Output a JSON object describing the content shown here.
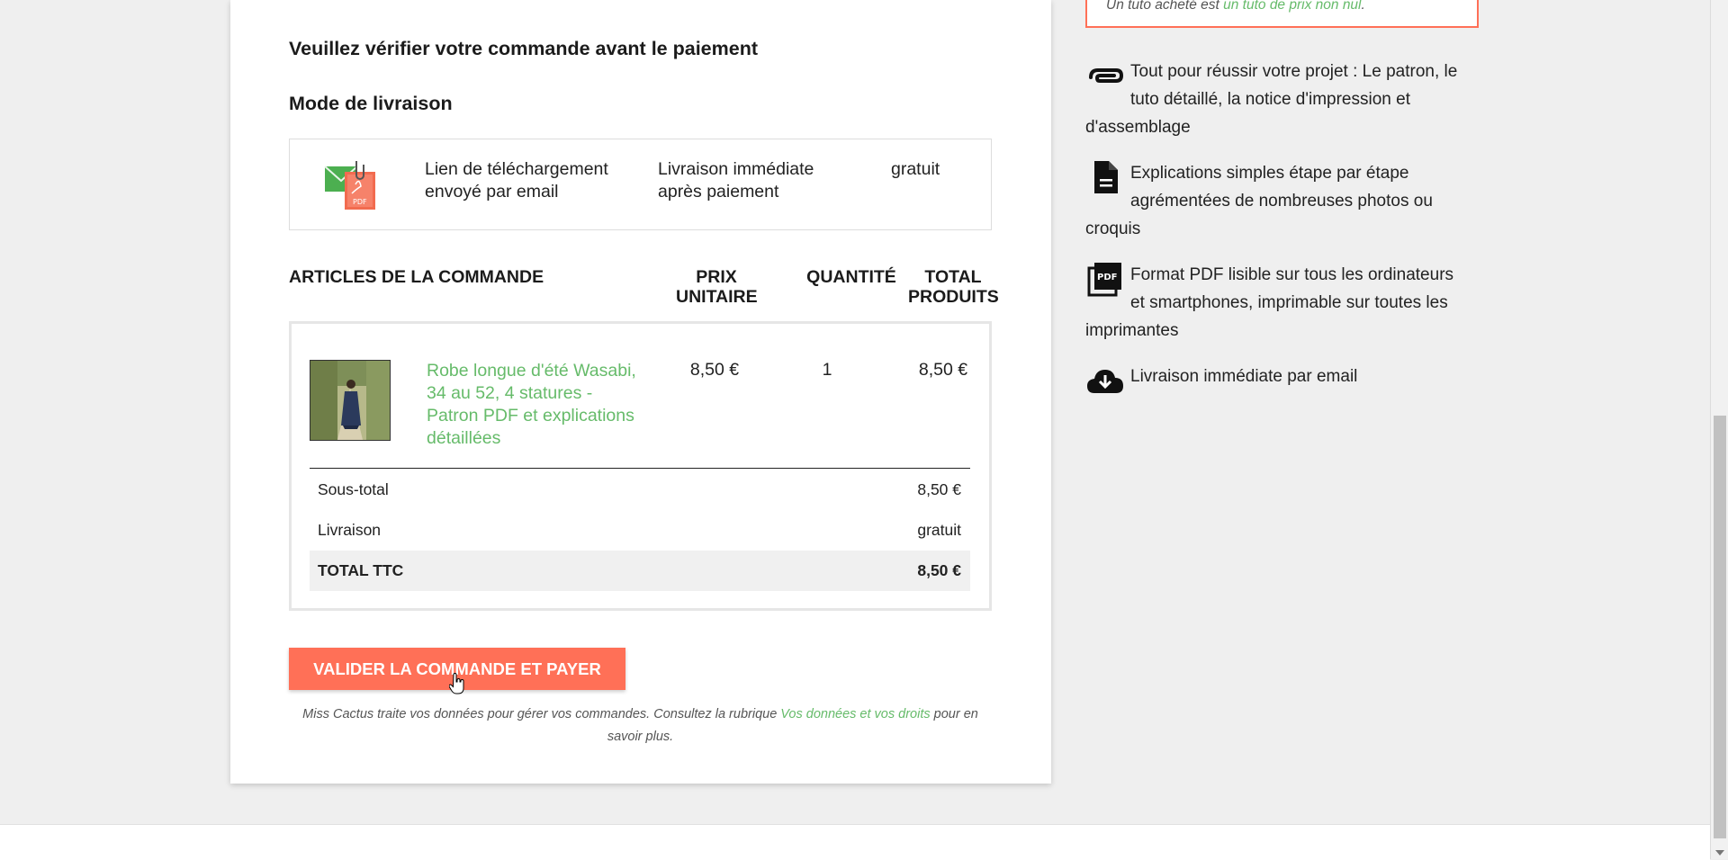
{
  "checkout": {
    "verify_title": "Veuillez vérifier votre commande avant le paiement",
    "shipping_title": "Mode de livraison",
    "shipping": {
      "icon": "pdf-email-icon",
      "method": "Lien de téléchargement envoyé par email",
      "delay": "Livraison immédiate après paiement",
      "price": "gratuit"
    },
    "table_headers": {
      "articles": "ARTICLES DE LA COMMANDE",
      "unit_price": "PRIX UNITAIRE",
      "quantity": "QUANTITÉ",
      "total": "TOTAL PRODUITS"
    },
    "item": {
      "name": "Robe longue d'été Wasabi, 34 au 52, 4 statures - Patron PDF et explications détaillées",
      "unit_price": "8,50 €",
      "quantity": "1",
      "total": "8,50 €"
    },
    "summary": {
      "subtotal_label": "Sous-total",
      "subtotal_value": "8,50 €",
      "shipping_label": "Livraison",
      "shipping_value": "gratuit",
      "total_label": "TOTAL TTC",
      "total_value": "8,50 €"
    },
    "cta_label": "VALIDER LA COMMANDE ET PAYER",
    "privacy": {
      "text_before": "Miss Cactus traite vos données pour gérer vos commandes. Consultez la rubrique ",
      "link": "Vos données et vos droits",
      "text_after": " pour en savoir plus."
    }
  },
  "sidebar": {
    "promo": {
      "text_before": "Un tuto acheté est ",
      "link": "un tuto de prix non nul",
      "text_after": "."
    },
    "features": [
      {
        "icon": "paperclip-icon",
        "text": "Tout pour réussir votre projet : Le patron, le tuto détaillé, la notice d'impression et d'assemblage"
      },
      {
        "icon": "document-icon",
        "text": "Explications simples étape par étape agrémentées de nombreuses photos ou croquis"
      },
      {
        "icon": "pdf-icon",
        "text": "Format PDF lisible sur tous les ordinateurs et smartphones, imprimable sur toutes les imprimantes"
      },
      {
        "icon": "cloud-download-icon",
        "text": "Livraison immédiate par email"
      }
    ]
  },
  "colors": {
    "accent": "#ff7057",
    "link": "#66bb6a",
    "background": "#efefef"
  }
}
